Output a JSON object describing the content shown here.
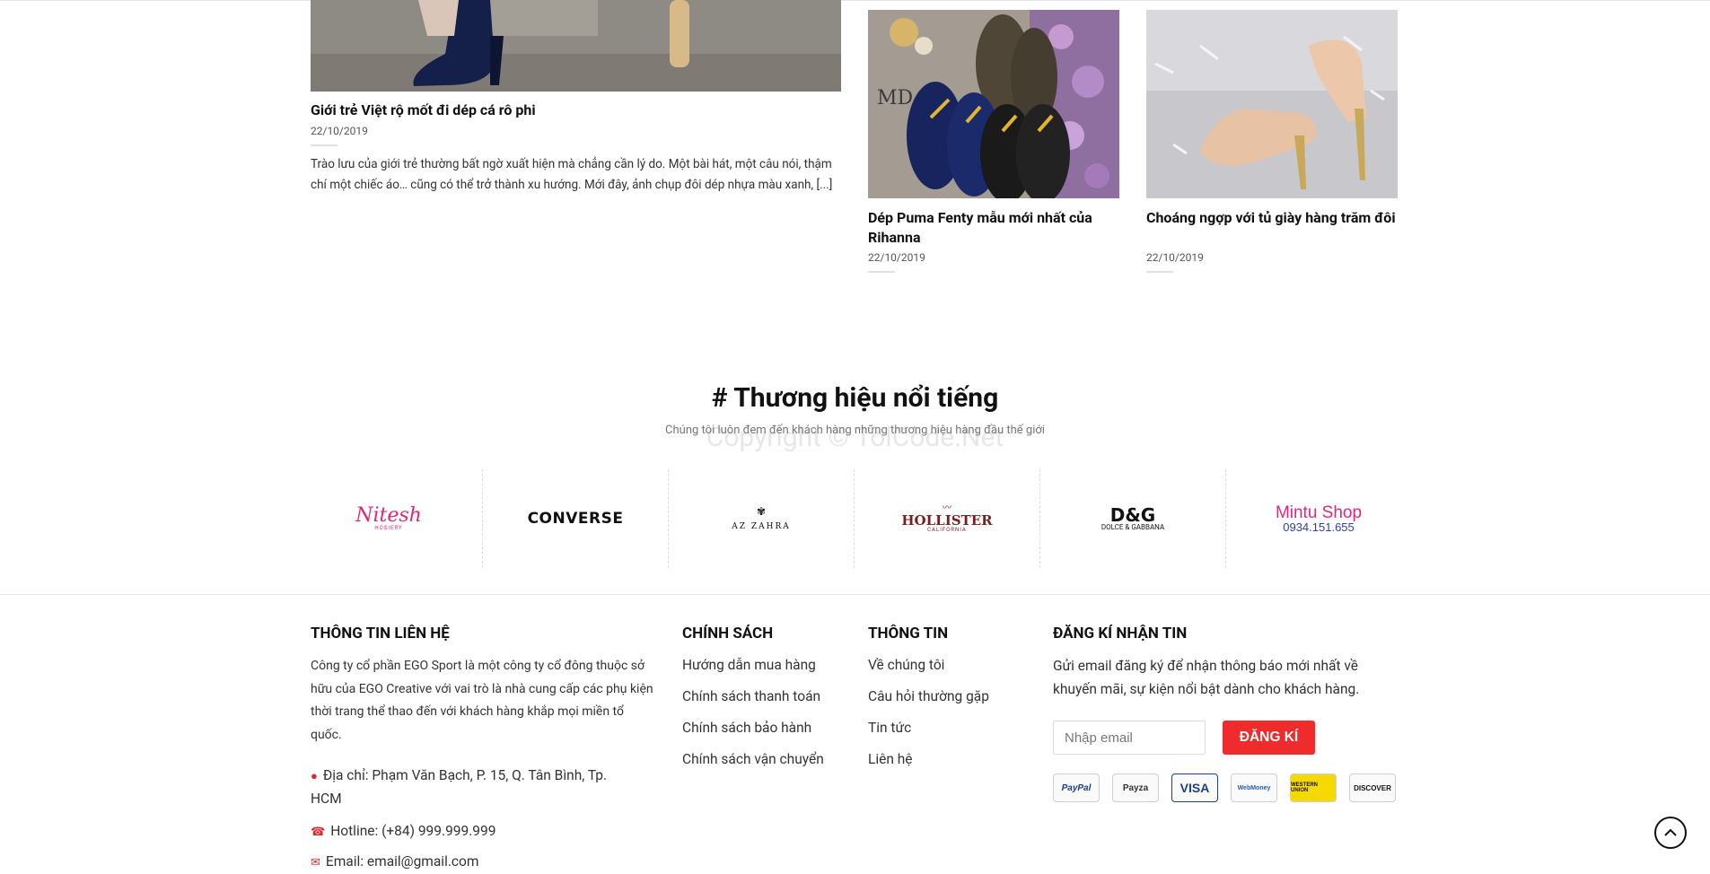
{
  "posts": {
    "main": {
      "title": "Giới trẻ Việt rộ mốt đi dép cá rô phi",
      "date": "22/10/2019",
      "excerpt": "Trào lưu của giới trẻ thường bất ngờ xuất hiện mà chẳng cần lý do. Một bài hát, một câu nói, thậm chí một chiếc áo… cũng có thể trở thành xu hướng. Mới đây, ảnh chụp đôi dép nhựa màu xanh, [...]"
    },
    "cards": [
      {
        "title": "Dép Puma Fenty mẫu mới nhất của Rihanna",
        "date": "22/10/2019",
        "watermark": "MD"
      },
      {
        "title": "Choáng ngợp với tủ giày hàng trăm đôi",
        "date": "22/10/2019"
      }
    ]
  },
  "brands": {
    "title": "# Thương hiệu nổi tiếng",
    "subtitle": "Chúng tôi luôn đem đến khách hàng những thương hiệu hàng đầu thế giới",
    "watermark": "Copyright © TolCode.Net",
    "logos": [
      {
        "name": "Nitesh",
        "sub": "HOSIERY"
      },
      {
        "name": "CONVERSE"
      },
      {
        "name": "AZ ZAHRA",
        "sub": ""
      },
      {
        "name": "HOLLISTER",
        "sub": "CALIFORNIA"
      },
      {
        "name": "D&G",
        "sub": "DOLCE & GABBANA"
      },
      {
        "name": "Mintu Shop",
        "sub": "0934.151.655"
      }
    ]
  },
  "footer": {
    "contact": {
      "heading": "THÔNG TIN LIÊN HỆ",
      "about": "Công ty cổ phần EGO Sport là một công ty cổ đông thuộc sở hữu của EGO Creative với vai trò là nhà cung cấp các phụ kiện thời trang thể thao đến với khách hàng khắp mọi miền tổ quốc.",
      "address": "Địa chỉ: Phạm Văn Bạch, P. 15, Q. Tân Bình, Tp. HCM",
      "hotline": "Hotline: (+84) 999.999.999",
      "email": "Email: email@gmail.com"
    },
    "policy": {
      "heading": "CHÍNH SÁCH",
      "links": [
        "Hướng dẫn mua hàng",
        "Chính sách thanh toán",
        "Chính sách bảo hành",
        "Chính sách vận chuyển"
      ]
    },
    "info": {
      "heading": "THÔNG TIN",
      "links": [
        "Về chúng tôi",
        "Câu hỏi thường gặp",
        "Tin tức",
        "Liên hệ"
      ]
    },
    "newsletter": {
      "heading": "ĐĂNG KÍ NHẬN TIN",
      "text": "Gửi email đăng ký để nhận thông báo mới nhất về khuyến mãi, sự kiện nổi bật dành cho khách hàng.",
      "placeholder": "Nhập email",
      "button": "ĐĂNG KÍ"
    },
    "payments": [
      "PayPal",
      "Payza",
      "VISA",
      "WebMoney",
      "WESTERN UNION",
      "DISCOVER"
    ]
  },
  "icons": {
    "pin": "map-pin-icon",
    "phone": "phone-icon",
    "mail": "mail-icon",
    "scroll_top": "chevron-up-icon"
  },
  "colors": {
    "accent": "#ef2b2b",
    "pink": "#e0287a",
    "mintu_blue": "#2d3ea8"
  }
}
